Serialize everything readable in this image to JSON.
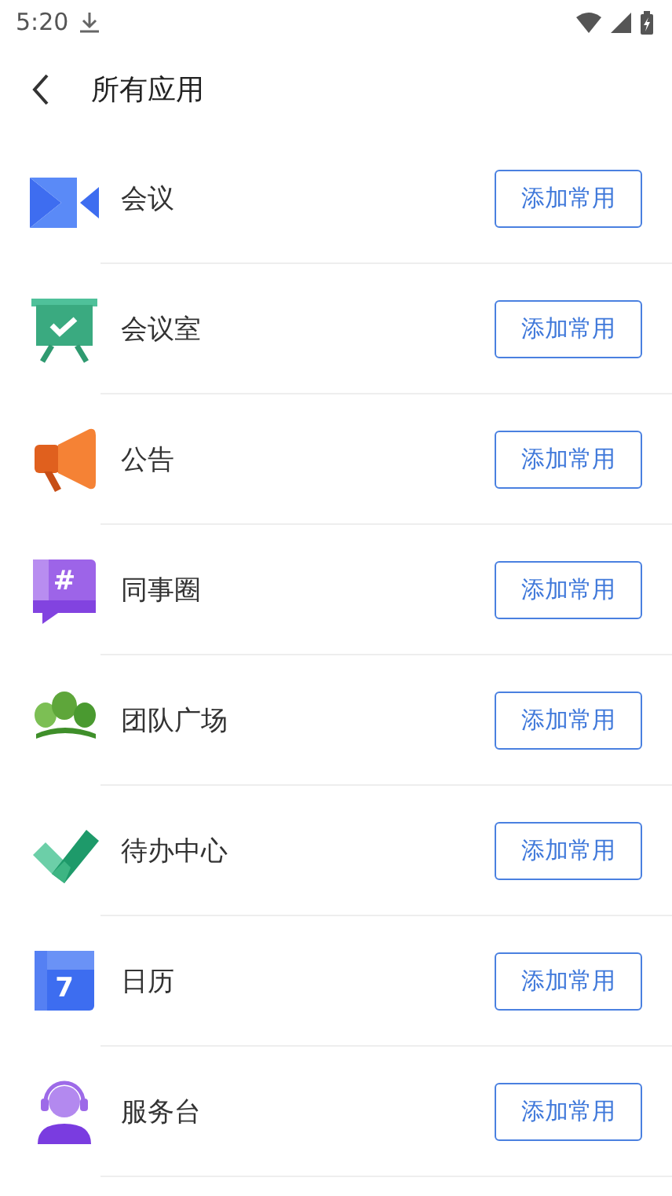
{
  "status_bar": {
    "time": "5:20"
  },
  "header": {
    "title": "所有应用"
  },
  "apps": [
    {
      "name": "会议",
      "kind": "camera",
      "button": "添加常用"
    },
    {
      "name": "会议室",
      "kind": "board",
      "button": "添加常用"
    },
    {
      "name": "公告",
      "kind": "megaphone",
      "button": "添加常用"
    },
    {
      "name": "同事圈",
      "kind": "hash",
      "icon_text": "#",
      "button": "添加常用"
    },
    {
      "name": "团队广场",
      "kind": "leaves",
      "button": "添加常用"
    },
    {
      "name": "待办中心",
      "kind": "check",
      "button": "添加常用"
    },
    {
      "name": "日历",
      "kind": "calendar",
      "icon_text": "7",
      "button": "添加常用"
    },
    {
      "name": "服务台",
      "kind": "agent",
      "button": "添加常用"
    }
  ]
}
